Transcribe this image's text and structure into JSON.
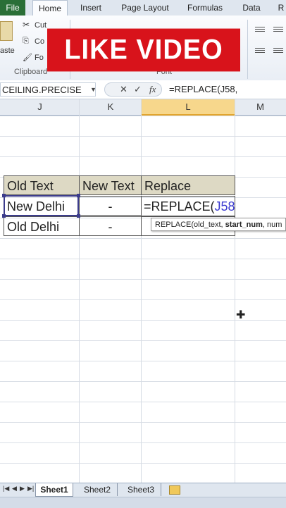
{
  "ribbon": {
    "tabs": [
      "File",
      "Home",
      "Insert",
      "Page Layout",
      "Formulas",
      "Data",
      "R"
    ],
    "clipboard": {
      "cut": "Cut",
      "copy": "Co",
      "format": "Fo",
      "paste": "aste",
      "group_label": "Clipboard"
    },
    "font_group_label": "Font",
    "overlay": "LIKE VIDEO"
  },
  "formula_bar": {
    "name_box": "CEILING.PRECISE",
    "cancel": "✕",
    "enter": "✓",
    "fx": "fx",
    "formula": "=REPLACE(J58,"
  },
  "columns": [
    "J",
    "K",
    "L",
    "M"
  ],
  "table": {
    "headers": [
      "Old Text",
      "New Text",
      "Replace"
    ],
    "rows": [
      [
        "New Delhi",
        "-"
      ],
      [
        "Old Delhi",
        "-"
      ]
    ],
    "editing": {
      "prefix": "=REPLACE(",
      "ref": "J58",
      "suffix": ","
    }
  },
  "tooltip": {
    "fn": "REPLACE(",
    "a1": "old_text, ",
    "a2": "start_num",
    "a3": ", num"
  },
  "sheets": [
    "Sheet1",
    "Sheet2",
    "Sheet3"
  ],
  "colors": {
    "file_tab": "#2a6f37",
    "overlay_bg": "#d8131b",
    "header_fill": "#ddd9c4",
    "selected_col": "#f7d78c"
  }
}
